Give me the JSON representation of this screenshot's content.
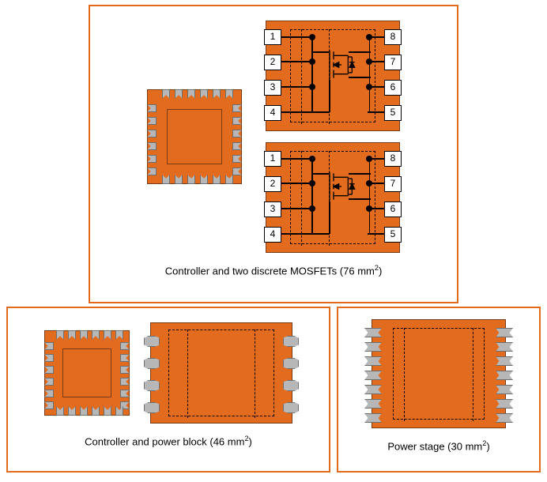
{
  "panels": {
    "top": {
      "caption_prefix": "Controller and two discrete MOSFETs (",
      "area": "76",
      "caption_suffix": " mm",
      "unit_sup": "2",
      "caption_close": ")"
    },
    "left": {
      "caption_prefix": "Controller and power block (",
      "area": "46",
      "caption_suffix": " mm",
      "unit_sup": "2",
      "caption_close": ")"
    },
    "right": {
      "caption_prefix": "Power stage (",
      "area": "30",
      "caption_suffix": " mm",
      "unit_sup": "2",
      "caption_close": ")"
    }
  },
  "mosfet_pins": [
    "1",
    "2",
    "3",
    "4",
    "5",
    "6",
    "7",
    "8"
  ]
}
